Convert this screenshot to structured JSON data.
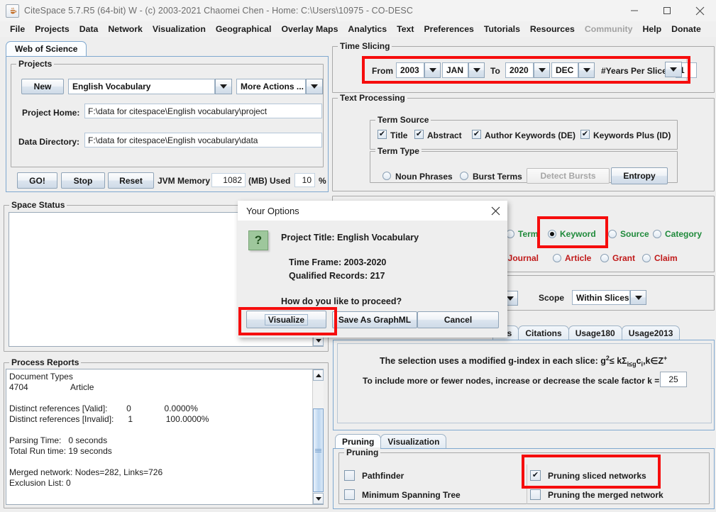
{
  "titlebar": {
    "icon": "java-coffee-icon",
    "title": "CiteSpace 5.7.R5 (64-bit) W - (c) 2003-2021 Chaomei Chen - Home: C:\\Users\\10975 - CO-DESC",
    "minimize": "minimize-icon",
    "maximize": "maximize-icon",
    "close": "close-icon"
  },
  "menubar": {
    "items": [
      {
        "label": "File",
        "dim": false
      },
      {
        "label": "Projects",
        "dim": false
      },
      {
        "label": "Data",
        "dim": false
      },
      {
        "label": "Network",
        "dim": false
      },
      {
        "label": "Visualization",
        "dim": false
      },
      {
        "label": "Geographical",
        "dim": false
      },
      {
        "label": "Overlay Maps",
        "dim": false
      },
      {
        "label": "Analytics",
        "dim": false
      },
      {
        "label": "Text",
        "dim": false
      },
      {
        "label": "Preferences",
        "dim": false
      },
      {
        "label": "Tutorials",
        "dim": false
      },
      {
        "label": "Resources",
        "dim": false
      },
      {
        "label": "Community",
        "dim": true
      },
      {
        "label": "Help",
        "dim": false
      },
      {
        "label": "Donate",
        "dim": false
      }
    ]
  },
  "left": {
    "tab_label": "Web of Science",
    "projects": {
      "group_label": "Projects",
      "new_button": "New",
      "project_combo_value": "English Vocabulary",
      "more_actions_value": "More Actions ...",
      "project_home_label": "Project Home:",
      "project_home_value": "F:\\data for citespace\\English vocabulary\\project",
      "data_directory_label": "Data Directory:",
      "data_directory_value": "F:\\data for citespace\\English vocabulary\\data"
    },
    "actions": {
      "go": "GO!",
      "stop": "Stop",
      "reset": "Reset",
      "jvm_label": "JVM Memory",
      "jvm_value": "1082",
      "mb_used_label": "(MB) Used",
      "percent_value": "10",
      "percent_sign": "%"
    },
    "space_status": {
      "group_label": "Space Status"
    },
    "process_reports": {
      "group_label": "Process Reports",
      "lines": [
        "Document Types",
        "4704                  Article",
        "",
        "Distinct references [Valid]:        0              0.0000%",
        "Distinct references [Invalid]:      1              100.0000%",
        "",
        "Parsing Time:   0 seconds",
        "Total Run time: 19 seconds",
        "",
        "Merged network: Nodes=282, Links=726",
        "Exclusion List: 0"
      ]
    }
  },
  "right": {
    "time_slicing": {
      "group_label": "Time Slicing",
      "from_label": "From",
      "from_year": "2003",
      "from_month": "JAN",
      "to_label": "To",
      "to_year": "2020",
      "to_month": "DEC",
      "years_per_slice_label": "#Years Per Slice",
      "years_per_slice_value": "1",
      "highlight_color": "#f60d0d"
    },
    "text_processing": {
      "group_label": "Text Processing",
      "term_source": {
        "group_label": "Term Source",
        "items": [
          {
            "label": "Title",
            "checked": true
          },
          {
            "label": "Abstract",
            "checked": true
          },
          {
            "label": "Author Keywords (DE)",
            "checked": true
          },
          {
            "label": "Keywords Plus (ID)",
            "checked": true
          }
        ]
      },
      "term_type": {
        "group_label": "Term Type",
        "noun_phrases": "Noun Phrases",
        "burst_terms": "Burst Terms",
        "detect_bursts_button": "Detect Bursts",
        "entropy_button": "Entropy"
      }
    },
    "node_types": {
      "row1": [
        {
          "label": "Term",
          "selected": false
        },
        {
          "label": "Keyword",
          "selected": true
        },
        {
          "label": "Source",
          "selected": false
        },
        {
          "label": "Category",
          "selected": false
        }
      ],
      "row2_partial_label": "d Journal",
      "row2": [
        {
          "label": "Article",
          "selected": false
        },
        {
          "label": "Grant",
          "selected": false
        },
        {
          "label": "Claim",
          "selected": false
        }
      ],
      "highlight_color": "#f60d0d",
      "green": "#1f8a3b",
      "red": "#c01919"
    },
    "scope": {
      "label": "Scope",
      "value": "Within Slices"
    },
    "selection_tabs": [
      {
        "label": "lds",
        "active": false
      },
      {
        "label": "Citations",
        "active": false
      },
      {
        "label": "Usage180",
        "active": false
      },
      {
        "label": "Usage2013",
        "active": false
      }
    ],
    "selection_panel": {
      "formula_prefix": "The selection uses a modified g-index in each slice: g",
      "formula_sup1": "2",
      "formula_mid": "≤ kΣ",
      "formula_sub1": "i≤g",
      "formula_c": "c",
      "formula_sub2": "i",
      "formula_tail": ",k∈Z",
      "formula_sup2": "+",
      "scale_text": "To include more or fewer nodes, increase or decrease the scale factor k =",
      "scale_value": "25"
    },
    "pruning": {
      "tabs": [
        {
          "label": "Pruning",
          "active": true
        },
        {
          "label": "Visualization",
          "active": false
        }
      ],
      "group_label": "Pruning",
      "options": [
        {
          "label": "Pathfinder",
          "checked": false
        },
        {
          "label": "Minimum Spanning Tree",
          "checked": false
        },
        {
          "label": "Pruning sliced networks",
          "checked": true
        },
        {
          "label": "Pruning the merged network",
          "checked": false
        }
      ],
      "highlight_color": "#f60d0d"
    }
  },
  "dialog": {
    "title": "Your Options",
    "close_icon": "close-icon",
    "question_icon": "question-icon",
    "project_title": "Project Title: English Vocabulary",
    "time_frame": "Time Frame: 2003-2020",
    "qualified_records": "Qualified Records: 217",
    "prompt": "How do you like to proceed?",
    "buttons": {
      "visualize": "Visualize",
      "save_as_graphml": "Save As GraphML",
      "cancel": "Cancel"
    },
    "highlight_color": "#f60d0d"
  }
}
